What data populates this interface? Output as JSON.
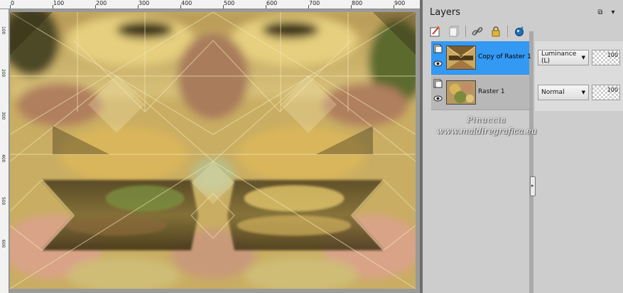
{
  "ruler": {
    "h_labels": [
      "0",
      "100",
      "200",
      "300",
      "400",
      "500",
      "600",
      "700",
      "800",
      "900"
    ],
    "v_labels": [
      "100",
      "200",
      "300",
      "400",
      "500",
      "600"
    ]
  },
  "panel": {
    "title": "Layers"
  },
  "layers": [
    {
      "name": "Copy of Raster 1",
      "blend_mode": "Luminance (L)",
      "opacity": "100",
      "selected": true,
      "visible": true
    },
    {
      "name": "Raster 1",
      "blend_mode": "Normal",
      "opacity": "100",
      "selected": false,
      "visible": true
    }
  ],
  "watermark": {
    "line1": "Pinuccia",
    "line2": "www.maldiregrafica.eu"
  },
  "colors": {
    "selected_layer": "#3399f3",
    "panel_bg": "#cdcdcd"
  }
}
